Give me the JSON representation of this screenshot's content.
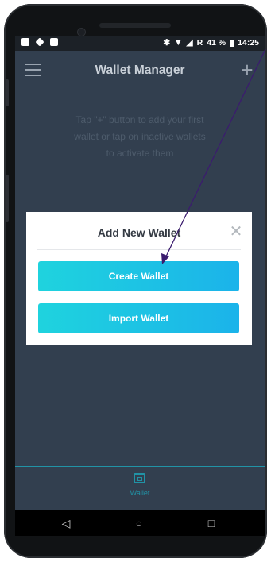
{
  "status_bar": {
    "battery": "41 %",
    "time": "14:25",
    "signal_text": "R"
  },
  "app": {
    "title": "Wallet Manager",
    "hint": "Tap \"+\" button to add your first wallet or tap on inactive wallets to activate them"
  },
  "dialog": {
    "title": "Add New Wallet",
    "create_label": "Create Wallet",
    "import_label": "Import Wallet"
  },
  "tabbar": {
    "wallet_label": "Wallet"
  },
  "icons": {
    "menu": "hamburger-menu-icon",
    "add": "plus-icon",
    "close": "close-icon",
    "wallet": "wallet-icon",
    "back": "back-triangle-icon",
    "home": "home-circle-icon",
    "recents": "recents-square-icon"
  },
  "colors": {
    "screen_bg": "#323f4f",
    "accent": "#2193a6",
    "button_gradient_start": "#1fd3de",
    "button_gradient_end": "#1bb3ea",
    "arrow": "#3b1c6e"
  }
}
